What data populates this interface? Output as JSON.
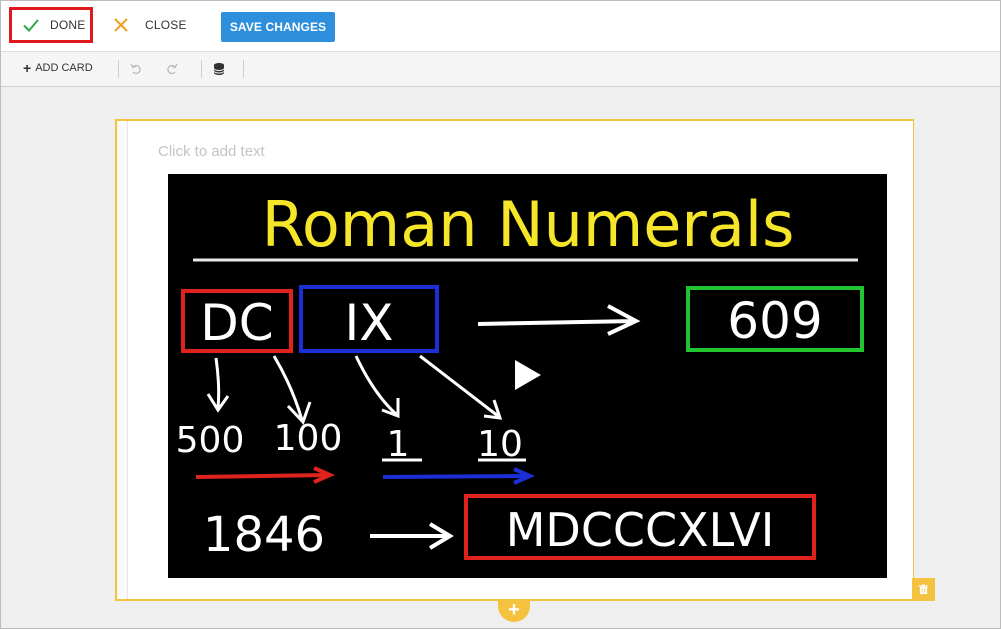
{
  "topbar": {
    "done_label": "DONE",
    "close_label": "CLOSE",
    "save_label": "SAVE CHANGES"
  },
  "toolbar": {
    "add_card_label": "ADD CARD",
    "icons": [
      "plus-icon",
      "undo-icon",
      "redo-icon",
      "database-icon"
    ]
  },
  "card": {
    "text_placeholder": "Click to add text",
    "video": {
      "title": "Roman Numerals",
      "board": {
        "example1_letters": [
          "DC",
          "IX"
        ],
        "example1_result": "609",
        "example1_values": [
          "500",
          "100",
          "1",
          "10"
        ],
        "example2_number": "1846",
        "example2_result": "MDCCCXLVI"
      }
    }
  },
  "colors": {
    "accent_yellow": "#f4c23e",
    "save_blue": "#2e8fdc",
    "done_highlight": "#e0191f",
    "done_check": "#2ea84a",
    "close_x": "#f0a020"
  },
  "icons": {
    "done": "check-icon",
    "close": "x-icon",
    "trash": "trash-icon",
    "add": "plus-icon",
    "play": "play-icon"
  }
}
